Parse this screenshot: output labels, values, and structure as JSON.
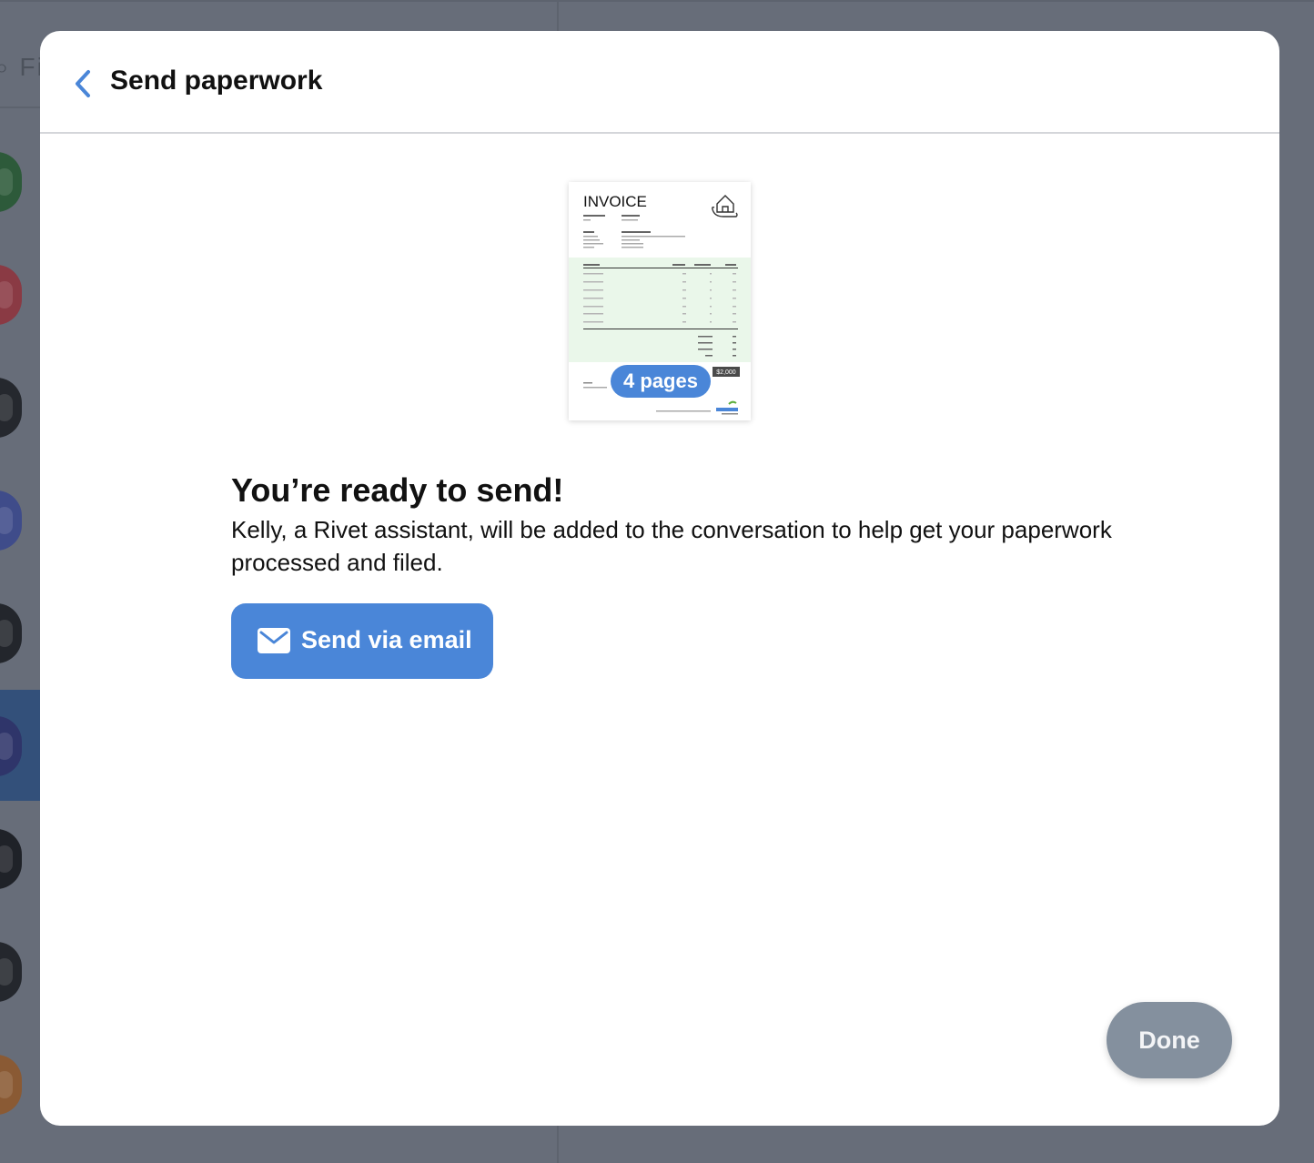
{
  "background": {
    "search_partial": "Fi"
  },
  "header": {
    "title": "Send paperwork",
    "back_icon": "chevron-left-icon"
  },
  "preview": {
    "doc_title": "INVOICE",
    "pages_badge": "4 pages",
    "total": "$2,000",
    "logo_icon": "house-hand-icon"
  },
  "ready": {
    "title": "You’re ready to send!",
    "description": "Kelly, a Rivet assistant, will be added to the conversation to help get your paperwork processed and filed."
  },
  "email_button": {
    "label": "Send via email",
    "icon": "envelope-icon"
  },
  "done_button": {
    "label": "Done"
  },
  "colors": {
    "accent": "#4a86d8",
    "done_disabled": "#84909e",
    "invoice_highlight": "#eaf7ea"
  }
}
